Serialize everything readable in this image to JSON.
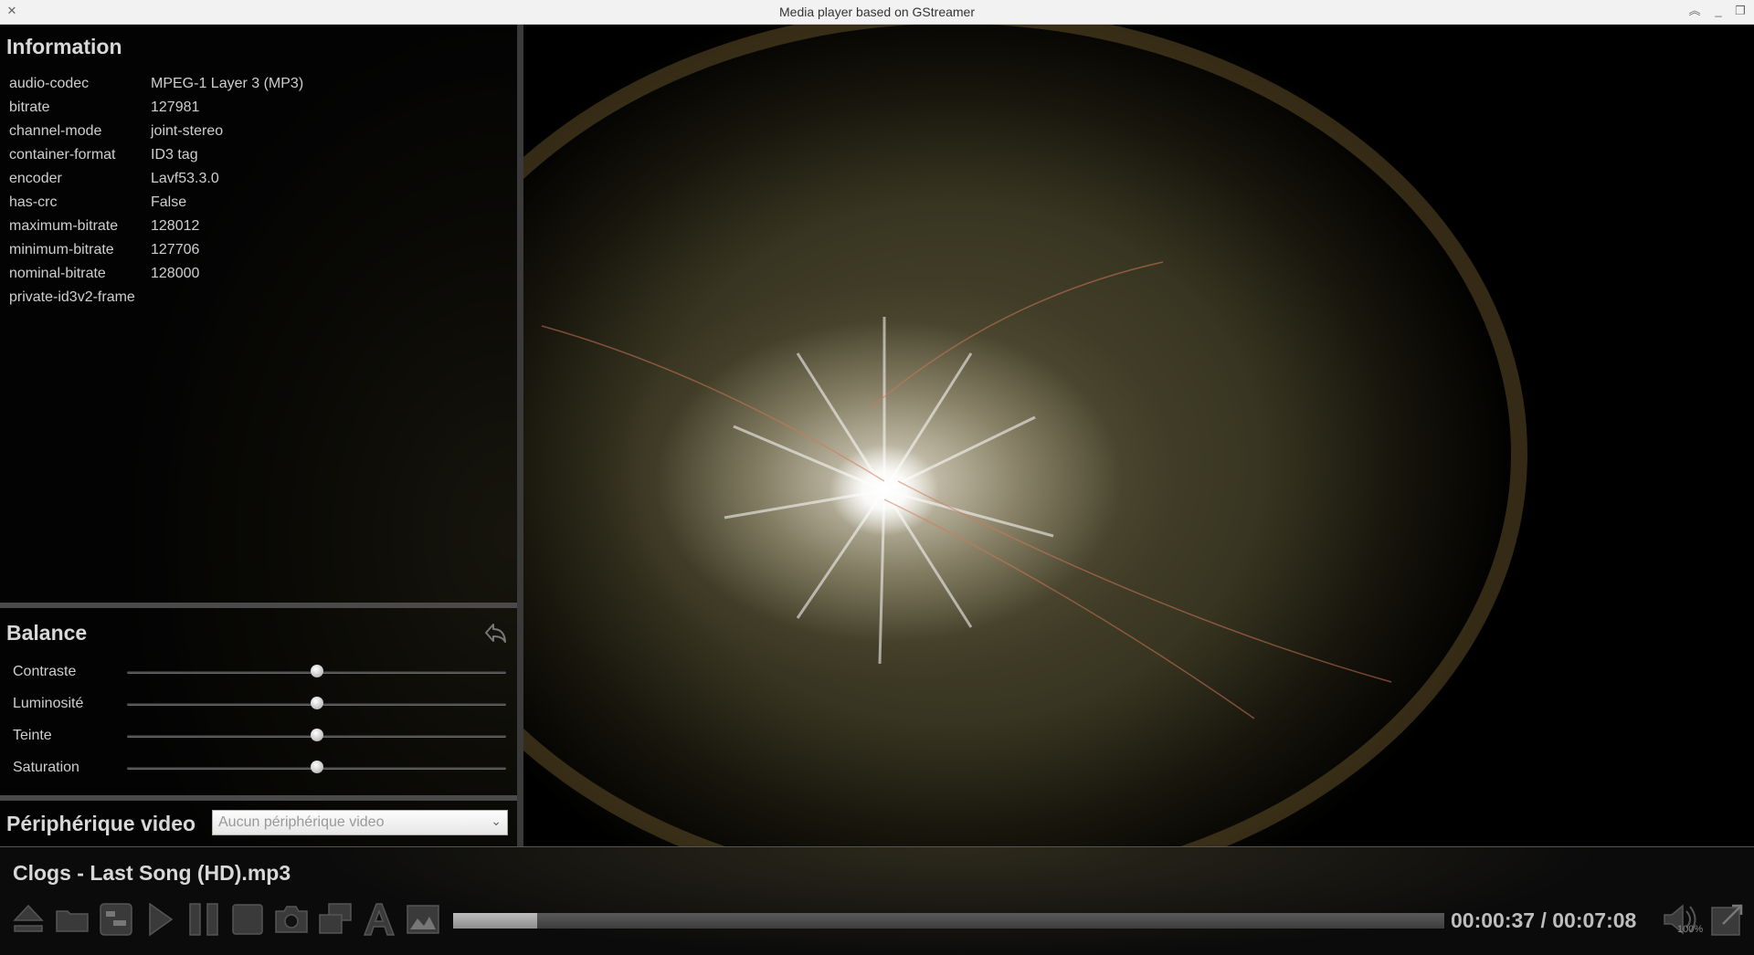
{
  "window": {
    "title": "Media player based on GStreamer"
  },
  "info": {
    "title": "Information",
    "rows": [
      {
        "key": "audio-codec",
        "value": "MPEG-1 Layer 3 (MP3)"
      },
      {
        "key": "bitrate",
        "value": "127981"
      },
      {
        "key": "channel-mode",
        "value": "joint-stereo"
      },
      {
        "key": "container-format",
        "value": "ID3 tag"
      },
      {
        "key": "encoder",
        "value": "Lavf53.3.0"
      },
      {
        "key": "has-crc",
        "value": "False"
      },
      {
        "key": "maximum-bitrate",
        "value": "128012"
      },
      {
        "key": "minimum-bitrate",
        "value": "127706"
      },
      {
        "key": "nominal-bitrate",
        "value": "128000"
      },
      {
        "key": "private-id3v2-frame",
        "value": ""
      }
    ]
  },
  "balance": {
    "title": "Balance",
    "sliders": [
      {
        "label": "Contraste",
        "level": 0.5
      },
      {
        "label": "Luminosité",
        "level": 0.5
      },
      {
        "label": "Teinte",
        "level": 0.5
      },
      {
        "label": "Saturation",
        "level": 0.5
      }
    ]
  },
  "video_device": {
    "label": "Périphérique video",
    "selected": "Aucun périphérique video"
  },
  "player": {
    "filename": "Clogs - Last Song (HD).mp3",
    "progress": 0.085,
    "time": "00:00:37 / 00:07:08",
    "volume": "100%"
  },
  "colors": {
    "panel_text": "#cfcfcf",
    "accent": "#d8d8d8",
    "titlebar_bg": "#f2f2f2"
  },
  "icons": [
    "close-icon",
    "maximize-icon",
    "minimize-icon",
    "restore-icon",
    "reset-icon",
    "eject-icon",
    "open-folder-icon",
    "settings-icon",
    "play-icon",
    "pause-icon",
    "stop-icon",
    "camera-icon",
    "windows-icon",
    "text-icon",
    "image-icon",
    "volume-icon",
    "fullscreen-icon",
    "chevron-down-icon"
  ]
}
